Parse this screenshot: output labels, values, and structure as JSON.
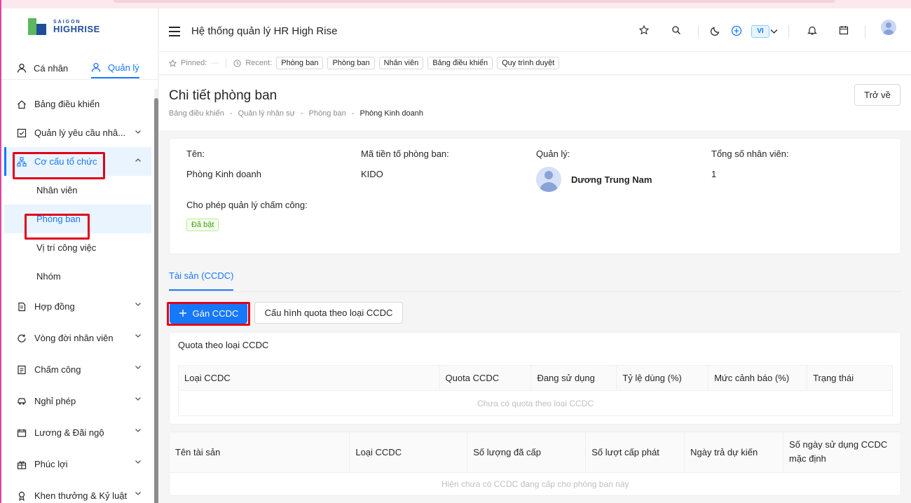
{
  "brand": {
    "line1": "SAIGON",
    "line2": "HIGHRISE"
  },
  "modes": {
    "personal": "Cá nhân",
    "manage": "Quản lý"
  },
  "sidebar": {
    "items": [
      {
        "label": "Bảng điều khiển",
        "icon": "home-icon"
      },
      {
        "label": "Quản lý yêu cầu nhâ...",
        "icon": "checkbox-icon"
      },
      {
        "label": "Cơ cấu tổ chức",
        "icon": "org-chart-icon"
      },
      {
        "label": "Hợp đồng",
        "icon": "contract-icon"
      },
      {
        "label": "Vòng đời nhân viên",
        "icon": "cycle-icon"
      },
      {
        "label": "Chấm công",
        "icon": "clipboard-icon"
      },
      {
        "label": "Nghỉ phép",
        "icon": "car-icon"
      },
      {
        "label": "Lương & Đãi ngộ",
        "icon": "wallet-icon"
      },
      {
        "label": "Phúc lợi",
        "icon": "gift-icon"
      },
      {
        "label": "Khen thưởng & Kỷ luật",
        "icon": "award-icon"
      }
    ],
    "subitems": [
      "Nhân viên",
      "Phòng ban",
      "Vị trí công việc",
      "Nhóm"
    ]
  },
  "header": {
    "title": "Hệ thống quản lý HR High Rise",
    "lang": "VI"
  },
  "pinbar": {
    "pinned_label": "Pinned:",
    "pinned_value": "—",
    "recent_label": "Recent:",
    "recent": [
      "Phòng ban",
      "Phòng ban",
      "Nhân viên",
      "Bảng điều khiển",
      "Quy trình duyệt"
    ]
  },
  "page": {
    "title": "Chi tiết phòng ban",
    "back": "Trở về",
    "breadcrumb": [
      "Bảng điều khiển",
      "Quản lý nhân sự",
      "Phòng ban",
      "Phòng Kinh doanh"
    ]
  },
  "detail": {
    "name_label": "Tên:",
    "name": "Phòng Kinh doanh",
    "code_label": "Mã tiền tố phòng ban:",
    "code": "KIDO",
    "manager_label": "Quản lý:",
    "manager": "Dương Trung Nam",
    "total_label": "Tổng số nhân viên:",
    "total": "1",
    "attendance_label": "Cho phép quản lý chấm công:",
    "attendance_tag": "Đã bật"
  },
  "tabs": {
    "assets": "Tài sản (CCDC)"
  },
  "actions": {
    "assign": "Gán CCDC",
    "config": "Cấu hình quota theo loại CCDC"
  },
  "quota": {
    "title": "Quota theo loại CCDC",
    "columns": [
      "Loại CCDC",
      "Quota CCDC",
      "Đang sử dụng",
      "Tỷ lệ dùng (%)",
      "Mức cảnh báo (%)",
      "Trạng thái"
    ],
    "empty": "Chưa có quota theo loại CCDC"
  },
  "assets": {
    "columns": [
      "Tên tài sản",
      "Loại CCDC",
      "Số lượng đã cấp",
      "Số lượt cấp phát",
      "Ngày trả dự kiến",
      "Số ngày sử dụng CCDC mặc định"
    ],
    "empty": "Hiện chưa có CCDC đang cấp cho phòng ban này"
  }
}
